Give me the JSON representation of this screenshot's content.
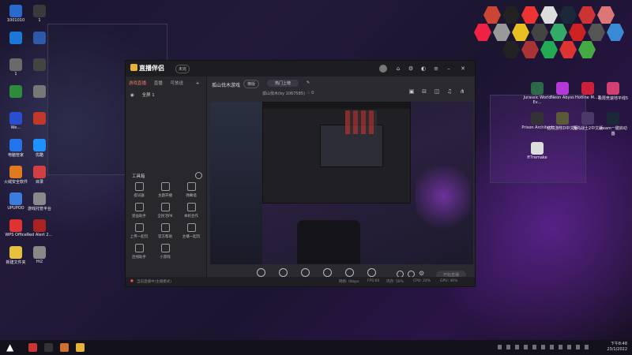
{
  "desktop": {
    "left_icons": [
      {
        "label": "1001010",
        "color": "#2a6acc"
      },
      {
        "label": "1",
        "color": "#3a3a3a"
      },
      {
        "label": "",
        "color": "#1d77d6"
      },
      {
        "label": "",
        "color": "#2d5aa8"
      },
      {
        "label": "1",
        "color": "#6a6a6a"
      },
      {
        "label": "",
        "color": "#444"
      },
      {
        "label": "",
        "color": "#2e8b3c"
      },
      {
        "label": "",
        "color": "#777"
      },
      {
        "label": "We…",
        "color": "#2a4ed0"
      },
      {
        "label": "",
        "color": "#c0392b"
      },
      {
        "label": "电脑管家",
        "color": "#2573e8"
      },
      {
        "label": "优酷",
        "color": "#1e90ff"
      },
      {
        "label": "火绒安全软件",
        "color": "#e07a1f"
      },
      {
        "label": "目录",
        "color": "#d04040"
      },
      {
        "label": "UPUPOO",
        "color": "#3b7ddd"
      },
      {
        "label": "游戏托管平台",
        "color": "#8a8a8a"
      },
      {
        "label": "WPS Office",
        "color": "#d33"
      },
      {
        "label": "Red Alert 2...",
        "color": "#aa2222"
      },
      {
        "label": "新建文件夹",
        "color": "#e8c040"
      },
      {
        "label": "Hi2",
        "color": "#888"
      }
    ],
    "right_icons": [
      {
        "label": "Jurassic World Ev…",
        "color": "#2a6a4a"
      },
      {
        "label": "Neon Abyss",
        "color": "#b43ad8"
      },
      {
        "label": "Hotline M…2",
        "color": "#cc1f3a"
      },
      {
        "label": "极限竞速地平线5",
        "color": "#d04070"
      },
      {
        "label": "Prison Architect",
        "color": "#333"
      },
      {
        "label": "边境游牧D中文版",
        "color": "#5a5a3a"
      },
      {
        "label": "混沌战士2中文版",
        "color": "#4a3a6a"
      },
      {
        "label": "steam一键启动器",
        "color": "#1b2838"
      },
      {
        "label": "ff7remake",
        "color": "#ddd"
      }
    ]
  },
  "app": {
    "title": "直播伴侣",
    "badge": "未完",
    "top_tabs": [
      "游戏直播",
      "直播",
      "可放送"
    ],
    "scene_label": "全屏 1",
    "tools_title": "工具箱",
    "tools": [
      "提词器",
      "主题开播",
      "弹幕墙",
      "受益助手",
      "全民活PK",
      "本机合作",
      "上传一起玩",
      "官方帮助",
      "主播一起玩",
      "连线助手",
      "小游戏"
    ],
    "game_name": "孤山伐木游戏",
    "game_tag": "横版",
    "topic_btn": "热门上榜",
    "sub_title": "孤山伐木(by 1067585)",
    "viewers": "0",
    "controls": [
      "直播屏幕",
      "摄像头",
      "手机投屏",
      "录播机",
      "麦克风",
      "扬声器"
    ],
    "go_live": "开始直播",
    "status": "当前直播中(主播模式)",
    "stats": [
      "网络: 0kbps",
      "FPS:60",
      "内存: 50%",
      "CPU: 24%",
      "GPU: 46%"
    ]
  },
  "taskbar": {
    "time": "下午8:48",
    "date": "23/1/2022"
  },
  "colors": {
    "accent": "#f07a6a",
    "brand": "#e7b23a"
  }
}
